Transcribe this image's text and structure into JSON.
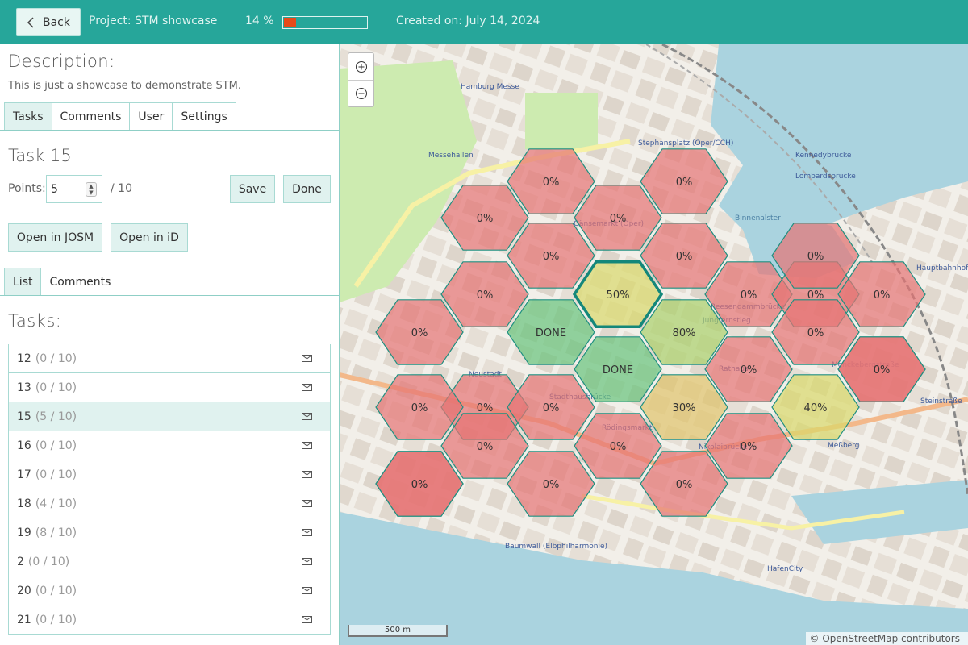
{
  "header": {
    "back_label": "Back",
    "project_label": "Project: STM showcase",
    "progress_text": "14 %",
    "progress_value": 0.14,
    "created_label": "Created on: July 14, 2024"
  },
  "colors": {
    "accent": "#26a69a",
    "progress_fill": "#e64a19",
    "cell_0": "#e57373",
    "cell_low": "#e0c36a",
    "cell_mid": "#d9d86a",
    "cell_done": "#66c37a"
  },
  "description": {
    "title": "Description:",
    "text": "This is just a showcase to demonstrate STM."
  },
  "main_tabs": [
    {
      "label": "Tasks",
      "active": true
    },
    {
      "label": "Comments",
      "active": false
    },
    {
      "label": "User",
      "active": false
    },
    {
      "label": "Settings",
      "active": false
    }
  ],
  "task": {
    "title": "Task 15",
    "points_label": "Points:",
    "points_value": "5",
    "points_max": "/ 10",
    "save_label": "Save",
    "done_label": "Done",
    "open_josm_label": "Open in JOSM",
    "open_id_label": "Open in iD"
  },
  "sub_tabs": [
    {
      "label": "List",
      "active": true
    },
    {
      "label": "Comments",
      "active": false
    }
  ],
  "tasks_heading": "Tasks:",
  "task_rows": [
    {
      "id": "12",
      "points": "(0 / 10)",
      "selected": false
    },
    {
      "id": "13",
      "points": "(0 / 10)",
      "selected": false
    },
    {
      "id": "15",
      "points": "(5 / 10)",
      "selected": true
    },
    {
      "id": "16",
      "points": "(0 / 10)",
      "selected": false
    },
    {
      "id": "17",
      "points": "(0 / 10)",
      "selected": false
    },
    {
      "id": "18",
      "points": "(4 / 10)",
      "selected": false
    },
    {
      "id": "19",
      "points": "(8 / 10)",
      "selected": false
    },
    {
      "id": "2",
      "points": "(0 / 10)",
      "selected": false
    },
    {
      "id": "20",
      "points": "(0 / 10)",
      "selected": false
    },
    {
      "id": "21",
      "points": "(0 / 10)",
      "selected": false
    }
  ],
  "map": {
    "zoom_in_icon": "plus-icon",
    "zoom_out_icon": "minus-icon",
    "scale_label": "500 m",
    "attribution_prefix": "©",
    "attribution_link": "OpenStreetMap",
    "attribution_suffix": "contributors",
    "place_labels": [
      "Hamburg Messe",
      "Messehallen",
      "Stephansplatz (Oper/CCH)",
      "Gänsemarkt (Oper)",
      "Jungfernstieg",
      "Rathaus",
      "Mönckebergstraße",
      "Hauptbahnhof Nord",
      "Stadthausbrücke",
      "Rödingsmarkt",
      "Neustadt",
      "HafenCity",
      "Baumwall (Elbphilharmonie)",
      "Meßberg",
      "Steinstraße",
      "Binnenalster",
      "Kennedybrücke",
      "Lombardsbrücke",
      "Reesendammbrücke",
      "Nikolaibrücke"
    ],
    "cells": [
      {
        "label": "0%",
        "status": "zero"
      },
      {
        "label": "0%",
        "status": "zero"
      },
      {
        "label": "0%",
        "status": "zero"
      },
      {
        "label": "0%",
        "status": "zero"
      },
      {
        "label": "0%",
        "status": "zero"
      },
      {
        "label": "0%",
        "status": "zero"
      },
      {
        "label": "0%",
        "status": "zero"
      },
      {
        "label": "50%",
        "status": "mid"
      },
      {
        "label": "0%",
        "status": "zero"
      },
      {
        "label": "0%",
        "status": "zero"
      },
      {
        "label": "0%",
        "status": "zero"
      },
      {
        "label": "0%",
        "status": "zero"
      },
      {
        "label": "DONE",
        "status": "done"
      },
      {
        "label": "80%",
        "status": "high"
      },
      {
        "label": "0%",
        "status": "zero"
      },
      {
        "label": "DONE",
        "status": "done"
      },
      {
        "label": "0%",
        "status": "zero"
      },
      {
        "label": "0%",
        "status": "zero"
      },
      {
        "label": "0%",
        "status": "zero"
      },
      {
        "label": "0%",
        "status": "zero"
      },
      {
        "label": "30%",
        "status": "low"
      },
      {
        "label": "40%",
        "status": "mid"
      },
      {
        "label": "0%",
        "status": "zero"
      },
      {
        "label": "0%",
        "status": "zero"
      },
      {
        "label": "0%",
        "status": "zero"
      },
      {
        "label": "0%",
        "status": "zero"
      },
      {
        "label": "0%",
        "status": "zero"
      },
      {
        "label": "0%",
        "status": "zero"
      },
      {
        "label": "0%",
        "status": "zero"
      },
      {
        "label": "0%",
        "status": "zero"
      },
      {
        "label": "0%",
        "status": "zero"
      },
      {
        "label": "0%",
        "status": "zero"
      }
    ]
  }
}
